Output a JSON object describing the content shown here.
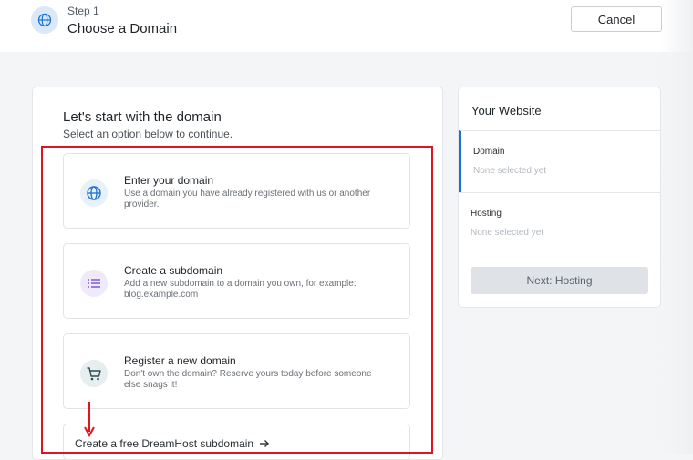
{
  "header": {
    "step_label": "Step 1",
    "step_title": "Choose a Domain",
    "cancel_label": "Cancel"
  },
  "main": {
    "title": "Let's start with the domain",
    "subtitle": "Select an option below to continue.",
    "options": [
      {
        "title": "Enter your domain",
        "description": "Use a domain you have already registered with us or another provider.",
        "icon": "globe-icon",
        "icon_bg": "#e8f0fa",
        "icon_color": "#1a73d0"
      },
      {
        "title": "Create a subdomain",
        "description": "Add a new subdomain to a domain you own, for example: blog.example.com",
        "icon": "list-icon",
        "icon_bg": "#efeafb",
        "icon_color": "#7b5bd6"
      },
      {
        "title": "Register a new domain",
        "description": "Don't own the domain? Reserve yours today before someone else snags it!",
        "icon": "cart-icon",
        "icon_bg": "#e6eef0",
        "icon_color": "#2f4a57"
      }
    ],
    "free_link": "Create a free DreamHost subdomain"
  },
  "sidebar": {
    "title": "Your Website",
    "rows": [
      {
        "label": "Domain",
        "value": "None selected yet"
      },
      {
        "label": "Hosting",
        "value": "None selected yet"
      }
    ],
    "next_button": "Next: Hosting"
  },
  "colors": {
    "accent": "#1a73d0",
    "highlight": "#e0141e"
  }
}
